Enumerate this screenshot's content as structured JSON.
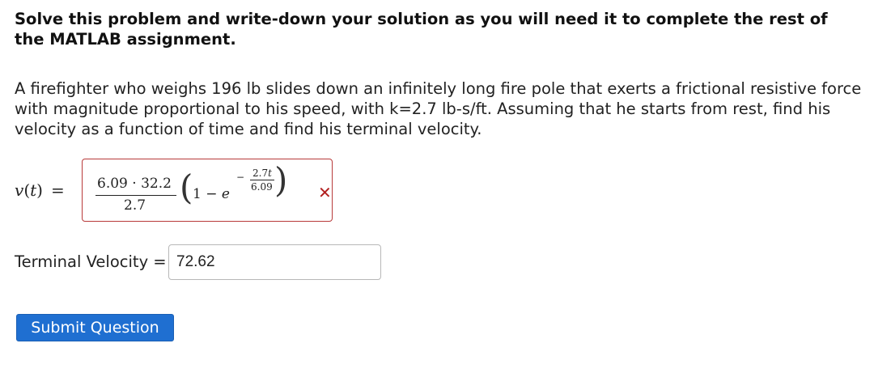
{
  "intro": "Solve this problem and write-down your solution as you will need it to complete the rest of the MATLAB assignment.",
  "problem_text": "A firefighter who weighs 196 lb slides down an infinitely long fire pole that exerts a frictional resistive force with magnitude proportional to his speed, with k=2.7 lb-s/ft. Assuming that he starts from rest, find his velocity as a function of time and find his terminal velocity.",
  "velocity": {
    "lhs_v": "v",
    "lhs_open": "(",
    "lhs_t": "t",
    "lhs_close": ")",
    "lhs_equals": "=",
    "answer": {
      "numerator": "6.09 · 32.2",
      "denominator": "2.7",
      "open_paren": "(",
      "one_minus": "1 − ",
      "e": "e",
      "exp_minus": "−",
      "exp_numerator_coef": "2.7",
      "exp_numerator_var": "t",
      "exp_denominator": "6.09",
      "close_paren": ")"
    },
    "status_mark": "✕",
    "status": "incorrect",
    "status_color": "#b21f1f"
  },
  "terminal_velocity": {
    "label": "Terminal Velocity =",
    "value": "72.62"
  },
  "submit_label": "Submit Question",
  "colors": {
    "button_bg": "#1f6fd1",
    "error_border": "#b83a3a"
  }
}
